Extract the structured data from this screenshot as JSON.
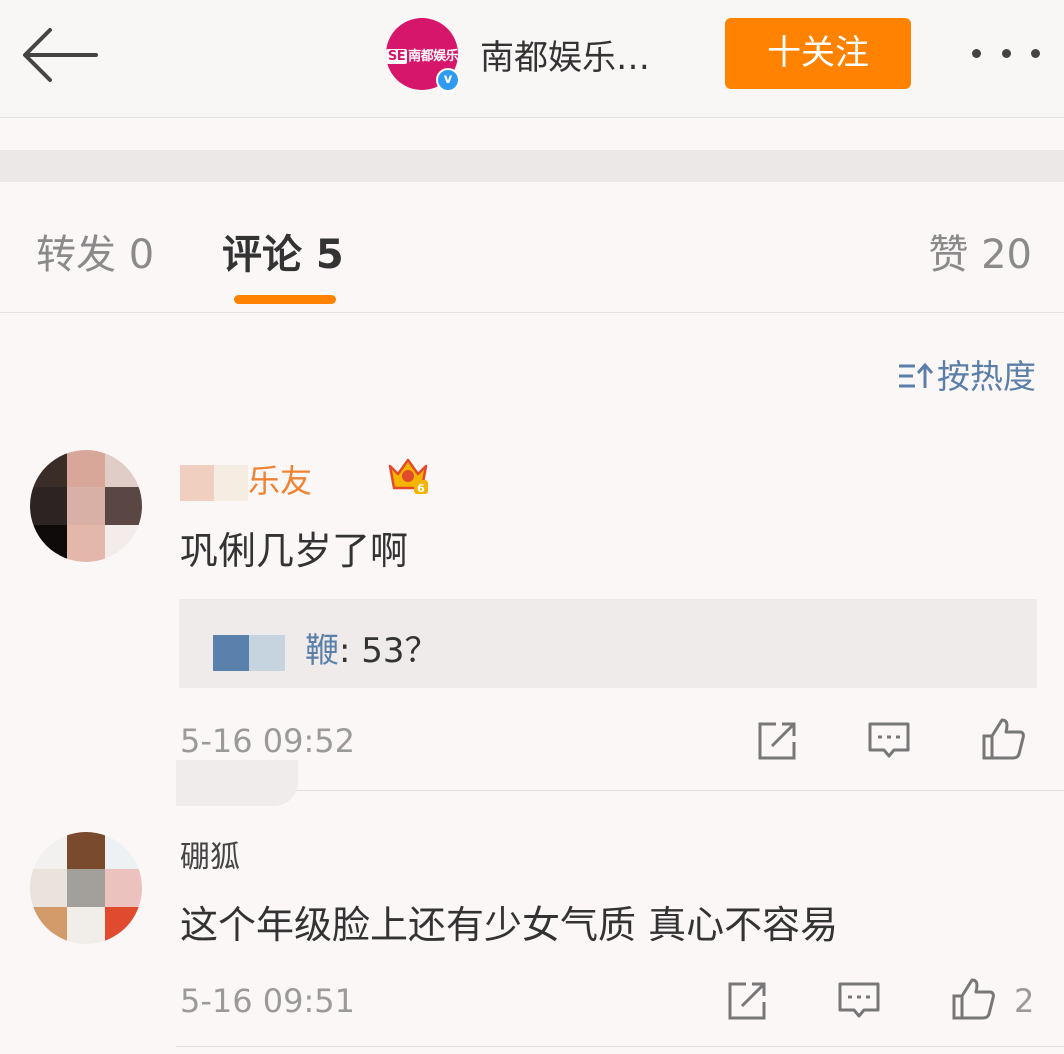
{
  "header": {
    "back_icon": "back-arrow-icon",
    "account_name": "南都娱乐…",
    "avatar_logo_text": "SE南都娱乐",
    "verified_icon": "verified-badge-icon",
    "follow_label": "十关注",
    "more_icon": "more-dots-icon"
  },
  "tabs": {
    "repost": "转发 0",
    "comments": "评论 5",
    "likes": "赞 20"
  },
  "sort": {
    "label": "按热度",
    "icon": "sort-icon"
  },
  "comments": [
    {
      "username": "乐友",
      "badge_icon": "crown-level-6-icon",
      "badge_level": "6",
      "text": "巩俐几岁了啊",
      "reply_author": "鞭",
      "reply_text": ": 53？",
      "time": "5-16 09:52"
    },
    {
      "username": "硼狐",
      "text": "这个年级脸上还有少女气质 真心不容易",
      "time": "5-16 09:51",
      "like_count": "2"
    }
  ],
  "colors": {
    "accent": "#ff8200",
    "link": "#5b7fa8",
    "brand": "#d6166a",
    "username_vip": "#f08234"
  }
}
